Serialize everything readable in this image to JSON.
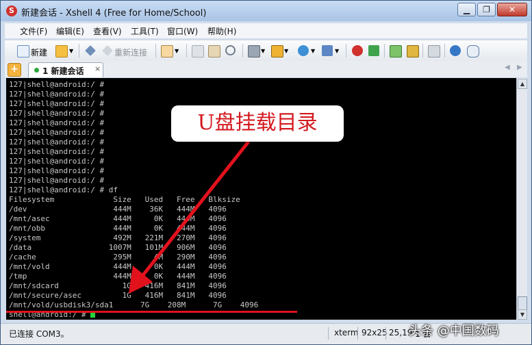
{
  "window": {
    "title": "新建会话 - Xshell 4 (Free for Home/School)",
    "controls": {
      "minimize": "▁",
      "restore": "❐",
      "close": "✕"
    }
  },
  "menu": [
    "文件(F)",
    "编辑(E)",
    "查看(V)",
    "工具(T)",
    "窗口(W)",
    "帮助(H)"
  ],
  "toolbar": {
    "new_label": "新建",
    "reconnect_label": "重新连接"
  },
  "tab": {
    "label": "1 新建会话",
    "close": "×"
  },
  "terminal": {
    "lines": [
      "127|shell@android:/ #",
      "127|shell@android:/ #",
      "127|shell@android:/ #",
      "127|shell@android:/ #",
      "127|shell@android:/ #",
      "127|shell@android:/ #",
      "127|shell@android:/ #",
      "127|shell@android:/ #",
      "127|shell@android:/ #",
      "127|shell@android:/ #",
      "127|shell@android:/ #",
      "127|shell@android:/ # df",
      "Filesystem             Size   Used   Free   Blksize",
      "/dev                   444M    36K   444M   4096",
      "/mnt/asec              444M     0K   444M   4096",
      "/mnt/obb               444M     0K   444M   4096",
      "/system                492M   221M   270M   4096",
      "/data                 1007M   101M   906M   4096",
      "/cache                 295M     4M   290M   4096",
      "/mnt/vold              444M     0K   444M   4096",
      "/tmp                   444M     0K   444M   4096",
      "/mnt/sdcard              1G   416M   841M   4096",
      "/mnt/secure/asec         1G   416M   841M   4096",
      "/mnt/vold/usbdisk3/sda1      7G    208M      7G    4096",
      "shell@android:/ # "
    ]
  },
  "annotation": {
    "callout": "U盘挂载目录"
  },
  "status": {
    "connection": "已连接 COM3。",
    "term": "xterm",
    "size": "92x25",
    "cursor": "25,19",
    "sessions": "1 会"
  },
  "watermark": "头条 @中国数码",
  "colors": {
    "cursor": "#25d43a",
    "annotation": "#e2121d",
    "terminal_bg": "#000000"
  }
}
